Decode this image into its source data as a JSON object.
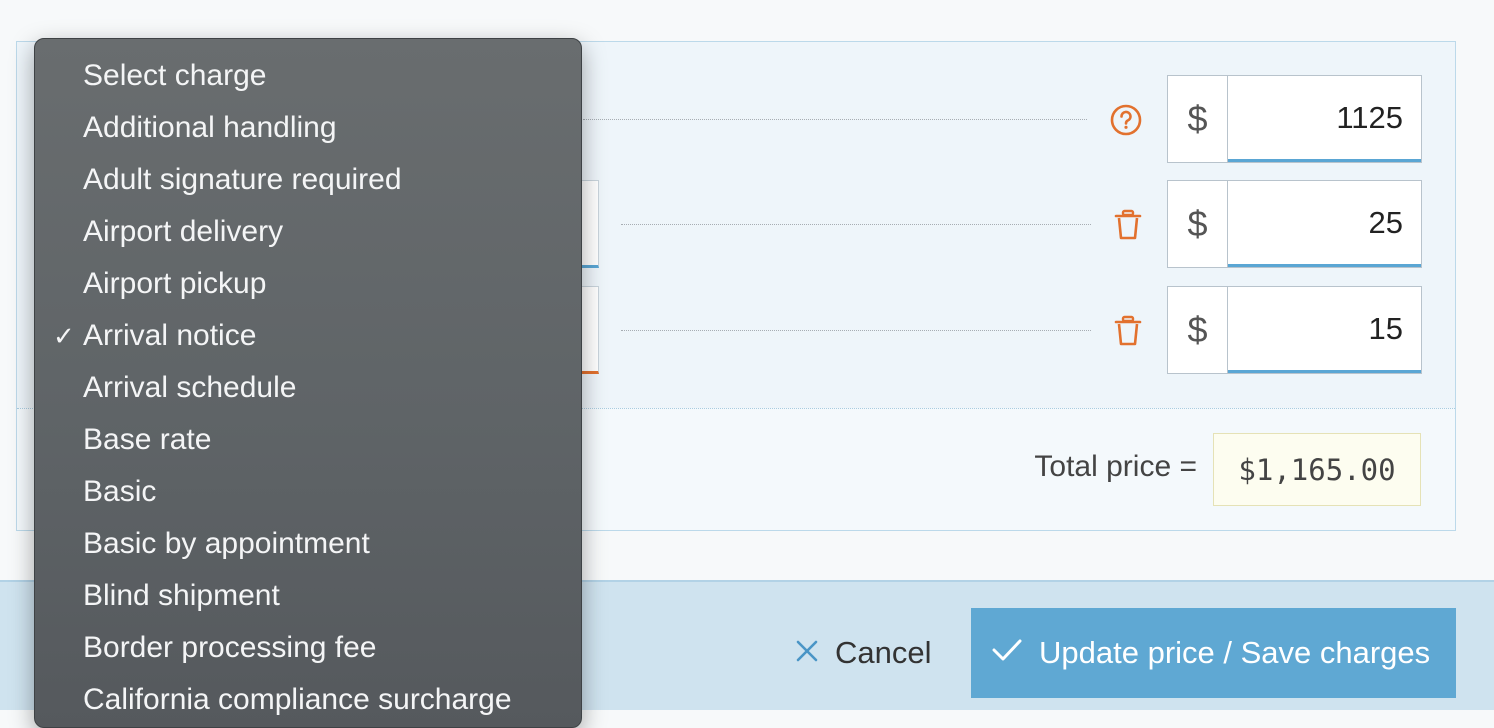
{
  "dropdown": {
    "options": [
      "Select charge",
      "Additional handling",
      "Adult signature required",
      "Airport delivery",
      "Airport pickup",
      "Arrival notice",
      "Arrival schedule",
      "Base rate",
      "Basic",
      "Basic by appointment",
      "Blind shipment",
      "Border processing fee",
      "California compliance surcharge"
    ],
    "selected": "Arrival notice",
    "checkmark": "✓"
  },
  "charges": [
    {
      "currency": "$",
      "amount": "1125",
      "icon": "help-circle-icon"
    },
    {
      "currency": "$",
      "amount": "25",
      "icon": "trash-icon"
    },
    {
      "currency": "$",
      "amount": "15",
      "icon": "trash-icon"
    }
  ],
  "total": {
    "label": "Total price =",
    "value": "$1,165.00"
  },
  "actions": {
    "cancel_label": "Cancel",
    "save_label": "Update price / Save charges"
  },
  "colors": {
    "accent": "#5fa8d3",
    "icon_orange": "#e2712e",
    "dropdown_bg": "#5f6467"
  }
}
